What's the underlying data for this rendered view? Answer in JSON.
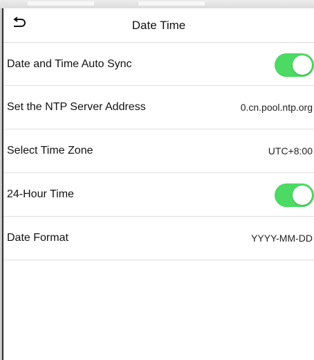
{
  "header": {
    "title": "Date Time",
    "back_icon": "back-arrow-icon"
  },
  "rows": [
    {
      "label": "Date and Time Auto Sync",
      "type": "toggle",
      "on": true
    },
    {
      "label": "Set the NTP Server Address",
      "type": "value",
      "value": "0.cn.pool.ntp.org"
    },
    {
      "label": "Select Time Zone",
      "type": "value",
      "value": "UTC+8:00"
    },
    {
      "label": "24-Hour Time",
      "type": "toggle",
      "on": true
    },
    {
      "label": "Date Format",
      "type": "value",
      "value": "YYYY-MM-DD"
    }
  ],
  "colors": {
    "toggle_on": "#4cd964",
    "background": "#ffffff",
    "divider": "#dedede"
  }
}
